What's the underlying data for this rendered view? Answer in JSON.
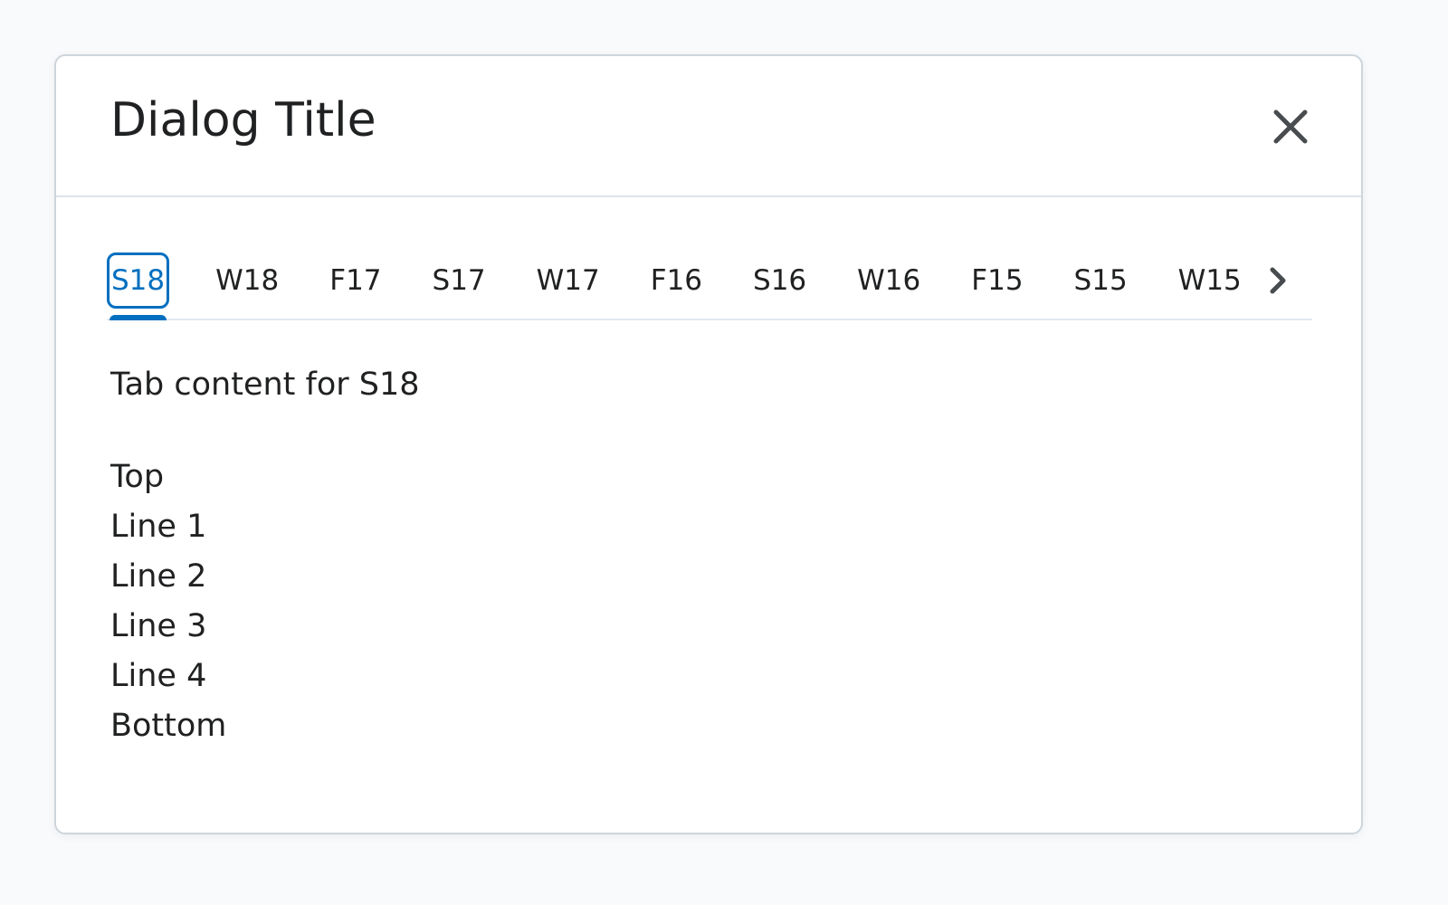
{
  "dialog": {
    "title": "Dialog Title",
    "close_icon": "close-icon"
  },
  "tabs": {
    "selected": "S18",
    "items": [
      {
        "label": "S18"
      },
      {
        "label": "W18"
      },
      {
        "label": "F17"
      },
      {
        "label": "S17"
      },
      {
        "label": "W17"
      },
      {
        "label": "F16"
      },
      {
        "label": "S16"
      },
      {
        "label": "W16"
      },
      {
        "label": "F15"
      },
      {
        "label": "S15"
      },
      {
        "label": "W15"
      }
    ],
    "scroll_icon": "chevron-right-icon"
  },
  "panel": {
    "content_title": "Tab content for S18",
    "lines": [
      "Top",
      "Line 1",
      "Line 2",
      "Line 3",
      "Line 4",
      "Bottom"
    ]
  },
  "colors": {
    "accent": "#006fbf",
    "text": "#202122",
    "divider": "#dfe4ea",
    "page_background": "#f9fafc"
  }
}
